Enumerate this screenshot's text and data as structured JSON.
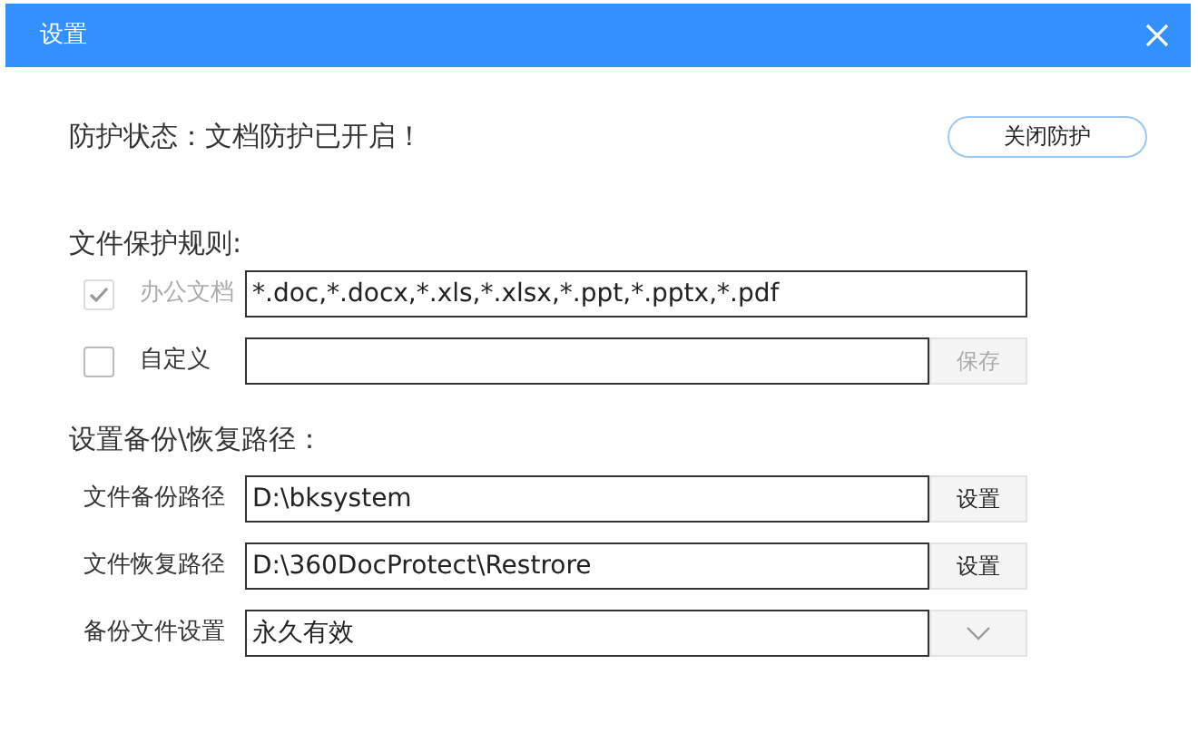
{
  "window": {
    "title": "设置"
  },
  "status": {
    "text": "防护状态：文档防护已开启！",
    "button": "关闭防护"
  },
  "rules": {
    "heading": "文件保护规则:",
    "items": [
      {
        "label": "办公文档",
        "checked": true,
        "disabled": true,
        "value": "*.doc,*.docx,*.xls,*.xlsx,*.ppt,*.pptx,*.pdf"
      },
      {
        "label": "自定义",
        "checked": false,
        "disabled": false,
        "value": "",
        "button": {
          "label": "保存",
          "disabled": true
        }
      }
    ]
  },
  "paths": {
    "heading": "设置备份\\恢复路径：",
    "rows": [
      {
        "kind": "path",
        "label": "文件备份路径",
        "value": "D:\\bksystem",
        "button": "设置"
      },
      {
        "kind": "path",
        "label": "文件恢复路径",
        "value": "D:\\360DocProtect\\Restrore",
        "button": "设置"
      },
      {
        "kind": "select",
        "label": "备份文件设置",
        "value": "永久有效"
      }
    ]
  }
}
